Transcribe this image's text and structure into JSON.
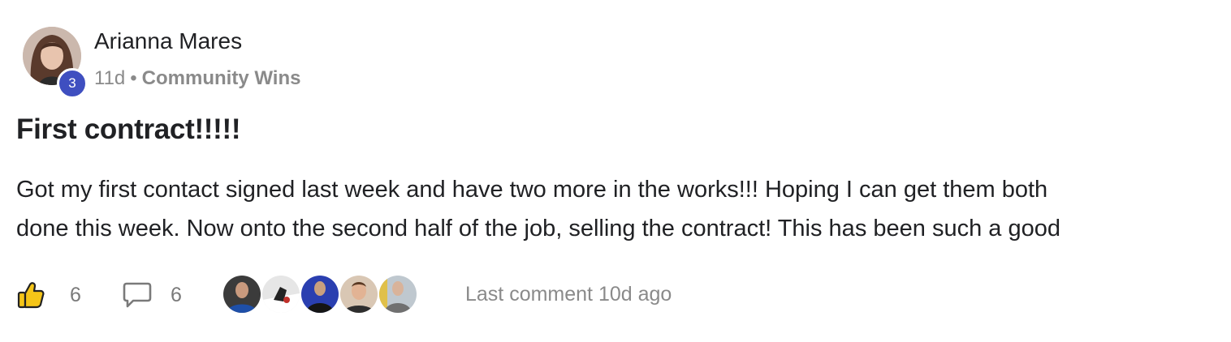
{
  "post": {
    "author": {
      "name": "Arianna Mares",
      "level": "3",
      "avatar_icon": "profile-photo-icon"
    },
    "meta": {
      "time": "11d",
      "separator": "•",
      "category": "Community Wins"
    },
    "title": "First contract!!!!!",
    "body_lines": [
      "Got my first contact signed last week and have two more in the works!!! Hoping I can get them both",
      "done this week. Now onto the second half of the job, selling the contract! This has been such a good"
    ],
    "footer": {
      "like_icon": "thumbs-up-icon",
      "likes": "6",
      "comment_icon": "comment-bubble-icon",
      "comments": "6",
      "last_comment": "Last comment 10d ago",
      "commenters": [
        "commenter-avatar-1",
        "commenter-avatar-2",
        "commenter-avatar-3",
        "commenter-avatar-4",
        "commenter-avatar-5"
      ]
    },
    "colors": {
      "badge": "#3f4fc0",
      "like_yellow": "#f5c518",
      "muted_text": "#8a8a8a"
    }
  }
}
